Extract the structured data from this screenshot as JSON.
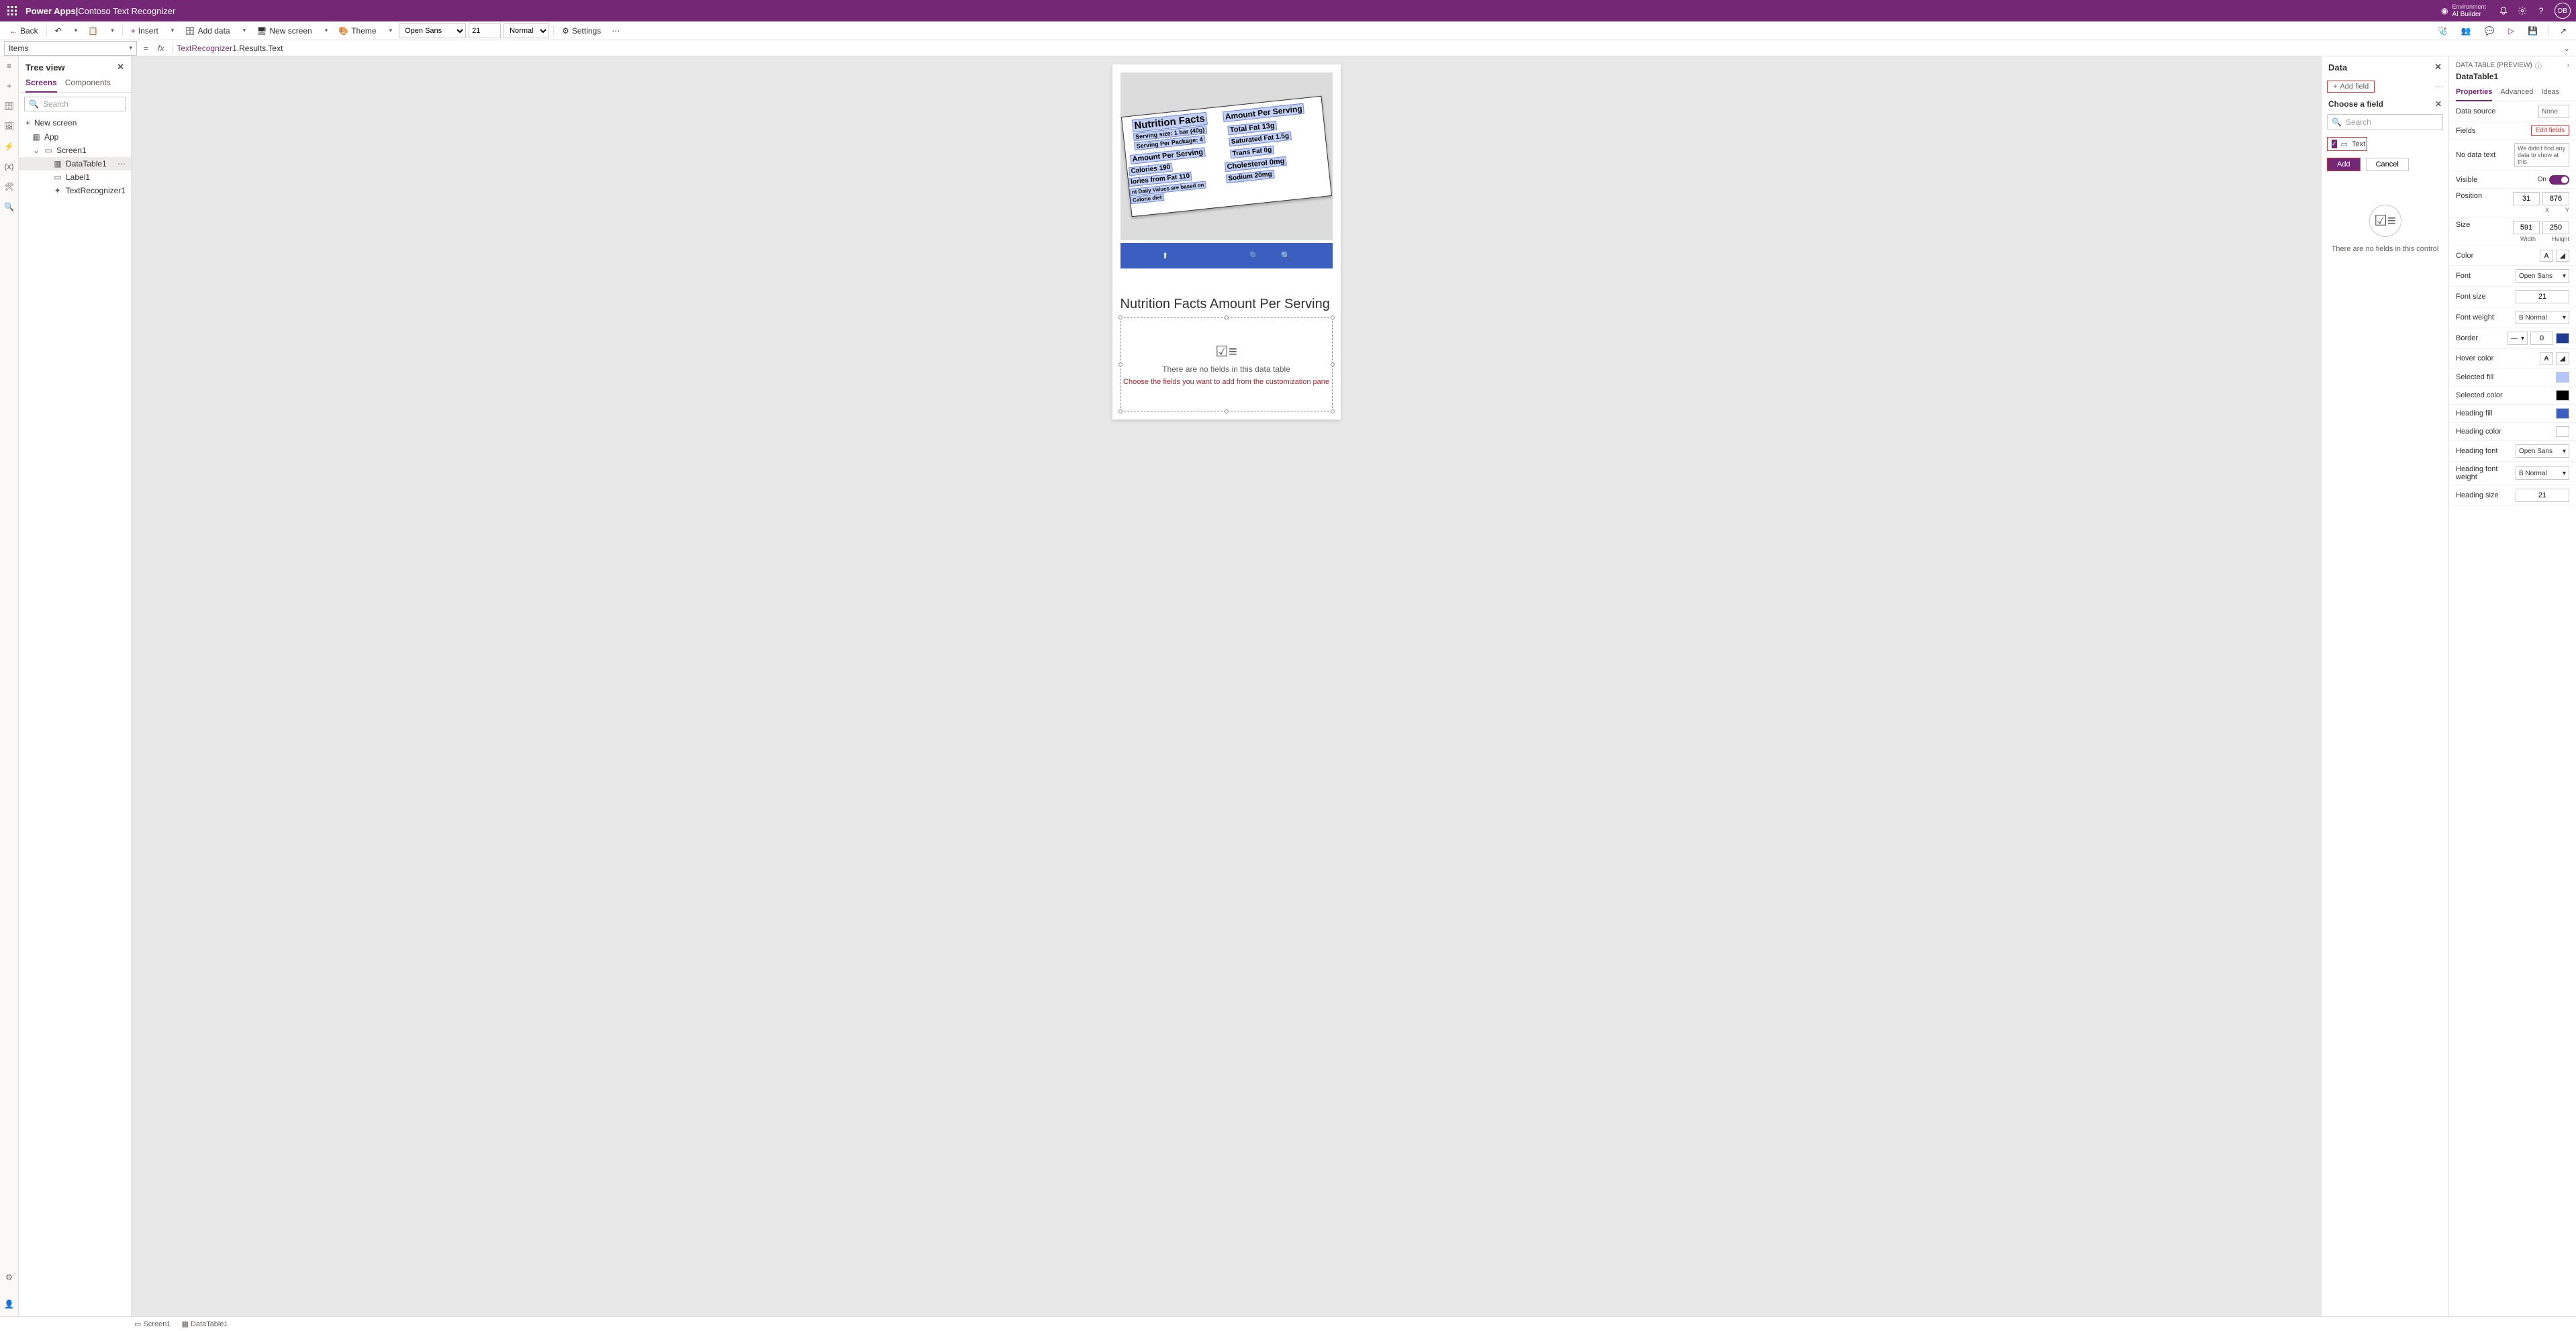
{
  "header": {
    "app": "Power Apps",
    "divider": "  |  ",
    "appname": "Contoso Text Recognizer",
    "env_label": "Environment",
    "env_name": "AI Builder",
    "avatar": "DB"
  },
  "cmdbar": {
    "back": "Back",
    "insert": "Insert",
    "adddata": "Add data",
    "newscreen": "New screen",
    "theme": "Theme",
    "font": "Open Sans",
    "size": "21",
    "weight": "Normal",
    "settings": "Settings"
  },
  "fbar": {
    "prop": "Items",
    "fx": "fx",
    "formula_tok": "TextRecognizer1",
    "formula_rest": ".Results.Text"
  },
  "tree": {
    "title": "Tree view",
    "tab_screens": "Screens",
    "tab_components": "Components",
    "search_ph": "Search",
    "newscreen": "New screen",
    "app": "App",
    "screen1": "Screen1",
    "datatable": "DataTable1",
    "label1": "Label1",
    "textrec": "TextRecognizer1"
  },
  "canvas": {
    "extracted_title": "Nutrition Facts Amount Per Serving",
    "dt_empty1": "There are no fields in this data table",
    "dt_empty2": "Choose the fields you want to add from the customization pane",
    "nutri": {
      "r1": "Nutrition Facts",
      "r1b": "Amount Per Serving",
      "r2": "Serving size: 1 bar (40g)",
      "r3": "Serving Per Package: 4",
      "r4": "Total Fat 13g",
      "r5": "Amount Per Serving",
      "r6": "Saturated Fat 1.5g",
      "r7": "Calories 190",
      "r8": "Trans Fat 0g",
      "r9": "lories from Fat 110",
      "r10": "Cholesterol 0mg",
      "r11": "nt Daily Values are based on",
      "r12": "Sodium 20mg",
      "r13": "Calorie diet"
    }
  },
  "datapanel": {
    "title": "Data",
    "addfield": "Add field",
    "choose": "Choose a field",
    "search_ph": "Search",
    "field_text": "Text",
    "btn_add": "Add",
    "btn_cancel": "Cancel",
    "empty": "There are no fields in this control"
  },
  "props": {
    "caption": "DATA TABLE (PREVIEW)",
    "control": "DataTable1",
    "tab_props": "Properties",
    "tab_adv": "Advanced",
    "tab_ideas": "Ideas",
    "datasource": "Data source",
    "datasource_val": "None",
    "fields": "Fields",
    "editfields": "Edit fields",
    "nodatatext": "No data text",
    "nodatatext_val": "We didn't find any data to show at this",
    "visible": "Visible",
    "visible_val": "On",
    "position": "Position",
    "pos_x": "31",
    "pos_y": "876",
    "pos_xl": "X",
    "pos_yl": "Y",
    "size": "Size",
    "size_w": "591",
    "size_h": "250",
    "size_wl": "Width",
    "size_hl": "Height",
    "color": "Color",
    "font": "Font",
    "font_val": "Open Sans",
    "fontsize": "Font size",
    "fontsize_val": "21",
    "fontweight": "Font weight",
    "fontweight_val": "B  Normal",
    "border": "Border",
    "border_val": "0",
    "hovercolor": "Hover color",
    "selectedfill": "Selected fill",
    "selectedcolor": "Selected color",
    "headingfill": "Heading fill",
    "headingcolor": "Heading color",
    "headingfont": "Heading font",
    "headingfont_val": "Open Sans",
    "headingfw": "Heading font weight",
    "headingfw_val": "B  Normal",
    "headingsize": "Heading size",
    "headingsize_val": "21"
  },
  "status": {
    "screen1": "Screen1",
    "datatable": "DataTable1"
  },
  "colors": {
    "border_swatch": "#1f3a93",
    "selectedfill": "#b3c7ff",
    "selectedcolor": "#000000",
    "headingfill": "#3b5fc0",
    "headingcolor": "#ffffff"
  }
}
